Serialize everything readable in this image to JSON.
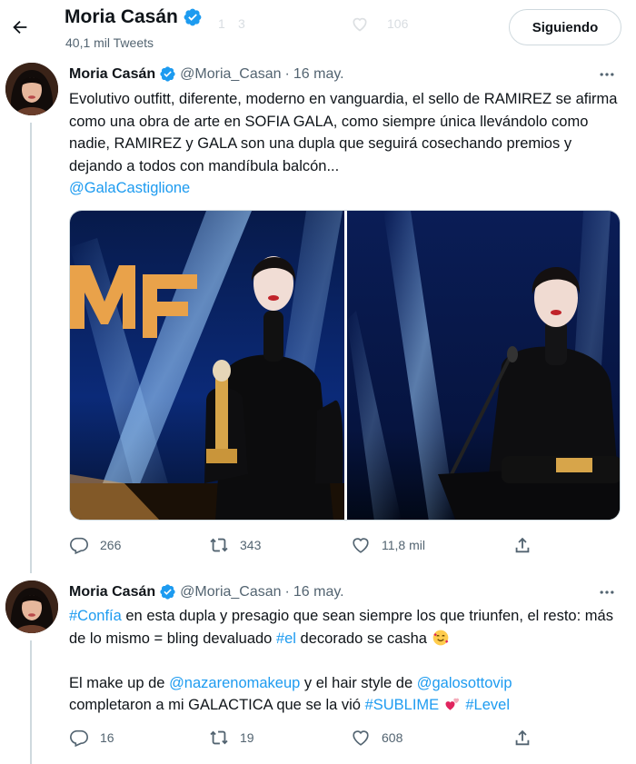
{
  "header": {
    "name": "Moria Casán",
    "tweet_count": "40,1 mil Tweets",
    "follow_label": "Siguiendo",
    "ghost_counts": [
      "1",
      "3",
      "106"
    ]
  },
  "tweets": [
    {
      "name": "Moria Casán",
      "handle": "@Moria_Casan",
      "dot": "·",
      "date": "16 may.",
      "text": "Evolutivo outfitt, diferente, moderno en vanguardia, el sello de RAMIREZ se afirma como una obra de arte en SOFIA GALA, como siempre única llevándolo como nadie, RAMIREZ y GALA son una dupla que seguirá cosechando premios y dejando a todos con mandíbula balcón...",
      "mention": "@GalaCastiglione",
      "replies": "266",
      "retweets": "343",
      "likes": "11,8 mil"
    },
    {
      "name": "Moria Casán",
      "handle": "@Moria_Casan",
      "dot": "·",
      "date": "16 may.",
      "hashtag_1": "#Confía",
      "text_1": " en esta dupla y presagio que sean siempre los que triunfen, el resto: más de lo mismo = bling devaluado ",
      "hashtag_2": "#el",
      "text_2": " decorado se casha ",
      "text_3": "El make up de ",
      "mention_1": "@nazarenomakeup",
      "text_4": " y el hair style de ",
      "mention_2": "@galosottovip",
      "text_5": "completaron a mi GALACTICA  que se la vió ",
      "hashtag_3": "#SUBLIME",
      "text_6": " ",
      "hashtag_4": "#Level",
      "replies": "16",
      "retweets": "19",
      "likes": "608"
    }
  ],
  "icons": {
    "back": "arrow-left-icon",
    "verified": "verified-badge-icon",
    "reply": "reply-icon",
    "retweet": "retweet-icon",
    "like": "heart-icon",
    "share": "share-icon",
    "more": "more-icon",
    "emoji_1": "smiling-face-with-hearts-icon",
    "emoji_2": "two-hearts-icon"
  },
  "colors": {
    "accent": "#1d9bf0",
    "text": "#0f1419",
    "secondary": "#536471",
    "border": "#cfd9de"
  }
}
